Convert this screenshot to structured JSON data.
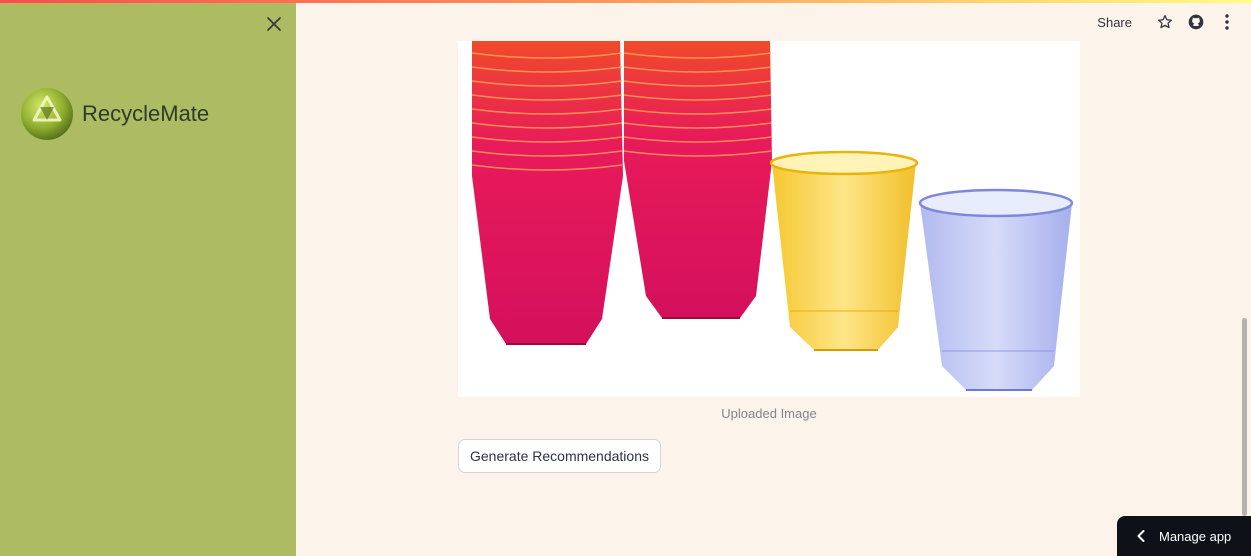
{
  "sidebar": {
    "app_name": "RecycleMate",
    "logo_icon": "recycle-logo-icon",
    "close_icon": "close-icon"
  },
  "header": {
    "share_label": "Share",
    "icons": [
      "star-icon",
      "github-icon",
      "more-vertical-icon"
    ]
  },
  "main": {
    "image_caption": "Uploaded Image",
    "generate_button": "Generate Recommendations"
  },
  "manage_app": {
    "label": "Manage app",
    "icon": "chevron-left-icon"
  },
  "colors": {
    "sidebar_bg": "#adbc62",
    "main_bg": "#fcf4ea",
    "manage_bg": "#0e1117"
  }
}
